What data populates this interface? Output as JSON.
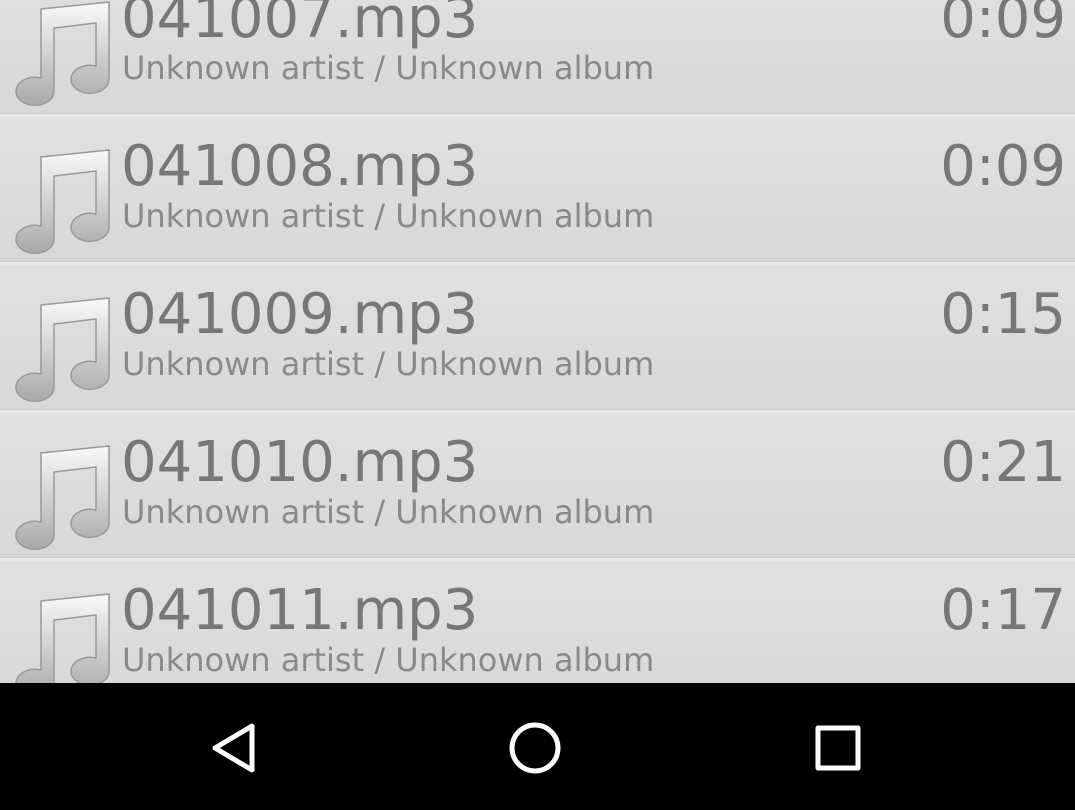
{
  "tracks": [
    {
      "title": "041007.mp3",
      "duration": "0:09",
      "meta": "Unknown artist / Unknown album",
      "icon": "music-note-icon"
    },
    {
      "title": "041008.mp3",
      "duration": "0:09",
      "meta": "Unknown artist / Unknown album",
      "icon": "music-note-icon"
    },
    {
      "title": "041009.mp3",
      "duration": "0:15",
      "meta": "Unknown artist / Unknown album",
      "icon": "music-note-icon"
    },
    {
      "title": "041010.mp3",
      "duration": "0:21",
      "meta": "Unknown artist / Unknown album",
      "icon": "music-note-icon"
    },
    {
      "title": "041011.mp3",
      "duration": "0:17",
      "meta": "Unknown artist / Unknown album",
      "icon": "music-note-icon"
    }
  ],
  "nav": {
    "back_icon": "back-triangle-icon",
    "home_icon": "home-circle-icon",
    "recents_icon": "recents-square-icon"
  },
  "colors": {
    "list_background": "#dddddd",
    "title_text": "#777777",
    "meta_text": "#8a8a8a",
    "nav_background": "#000000",
    "nav_icon": "#ffffff"
  }
}
